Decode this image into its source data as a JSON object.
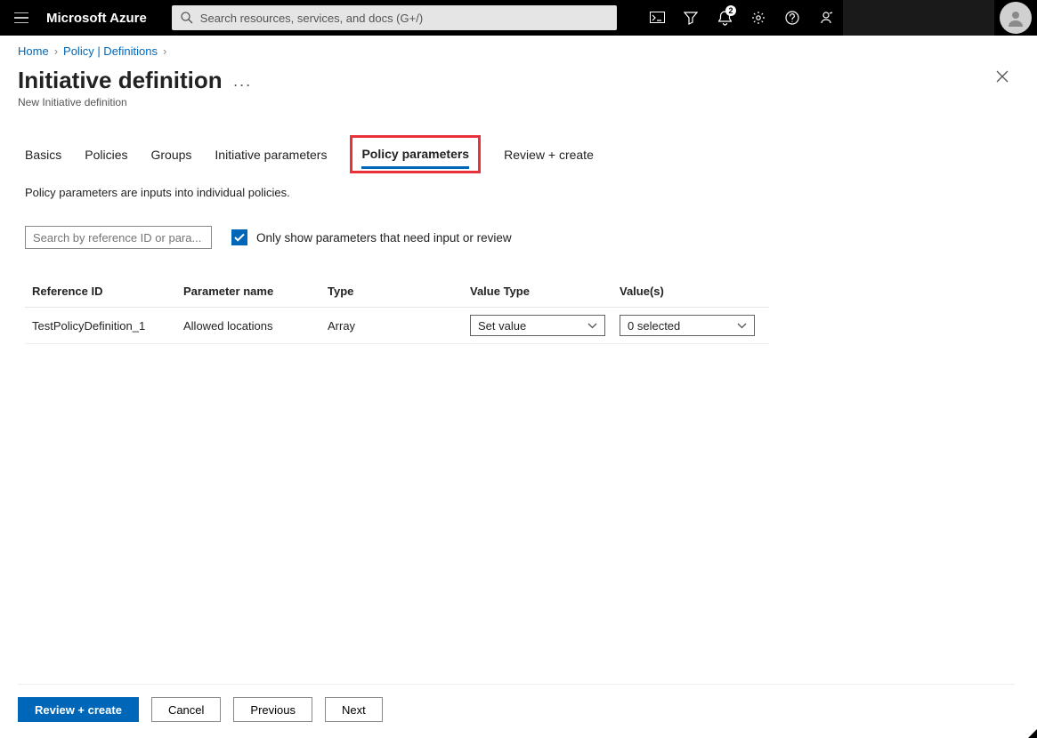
{
  "topbar": {
    "brand": "Microsoft Azure",
    "searchPlaceholder": "Search resources, services, and docs (G+/)",
    "notificationBadge": "2"
  },
  "breadcrumbs": {
    "items": [
      "Home",
      "Policy | Definitions"
    ]
  },
  "header": {
    "title": "Initiative definition",
    "subtitle": "New Initiative definition"
  },
  "tabs": {
    "items": [
      "Basics",
      "Policies",
      "Groups",
      "Initiative parameters",
      "Policy parameters",
      "Review + create"
    ],
    "activeIndex": 4
  },
  "description": "Policy parameters are inputs into individual policies.",
  "filter": {
    "searchPlaceholder": "Search by reference ID or para...",
    "checkboxLabel": "Only show parameters that need input or review",
    "checkboxChecked": true
  },
  "table": {
    "headers": [
      "Reference ID",
      "Parameter name",
      "Type",
      "Value Type",
      "Value(s)"
    ],
    "rows": [
      {
        "referenceId": "TestPolicyDefinition_1",
        "parameterName": "Allowed locations",
        "type": "Array",
        "valueType": "Set value",
        "values": "0 selected"
      }
    ]
  },
  "footer": {
    "reviewCreate": "Review + create",
    "cancel": "Cancel",
    "previous": "Previous",
    "next": "Next"
  }
}
